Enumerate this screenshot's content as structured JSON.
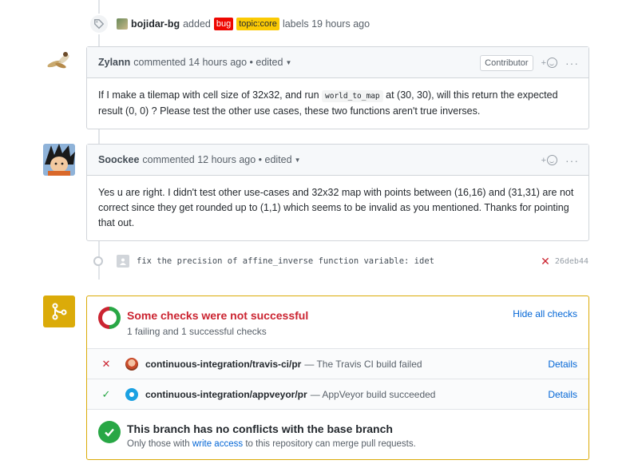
{
  "label_event": {
    "user": "bojidar-bg",
    "verb": "added",
    "labels": [
      "bug",
      "topic:core"
    ],
    "suffix": "labels 19 hours ago",
    "icon": "tag-icon"
  },
  "comments": [
    {
      "author": "Zylann",
      "meta": "commented 14 hours ago • edited",
      "role": "Contributor",
      "body_part1": "If I make a tilemap with cell size of 32x32, and run",
      "body_code": "world_to_map",
      "body_part2": "at (30, 30), will this return the expected result (0, 0) ? Please test the other use cases, these two functions aren't true inverses."
    },
    {
      "author": "Soockee",
      "meta": "commented 12 hours ago • edited",
      "body": "Yes u are right. I didn't test other use-cases and 32x32 map with points between (16,16) and (31,31) are not correct since they get rounded up to (1,1) which seems to be invalid as you mentioned. Thanks for pointing that out."
    }
  ],
  "commit": {
    "message": "fix the precision of affine_inverse function variable: idet",
    "status_icon": "x-icon",
    "sha": "26deb44"
  },
  "merge": {
    "checks_title": "Some checks were not successful",
    "checks_subtitle": "1 failing and 1 successful checks",
    "hide_label": "Hide all checks",
    "checks": [
      {
        "status": "fail",
        "name": "continuous-integration/travis-ci/pr",
        "description": "— The Travis CI build failed",
        "details": "Details"
      },
      {
        "status": "success",
        "name": "continuous-integration/appveyor/pr",
        "description": "— AppVeyor build succeeded",
        "details": "Details"
      }
    ],
    "conflict_title": "This branch has no conflicts with the base branch",
    "conflict_sub_prefix": "Only those with",
    "conflict_sub_link": "write access",
    "conflict_sub_suffix": "to this repository can merge pull requests."
  },
  "colors": {
    "fail": "#cb2431",
    "success": "#28a745",
    "warning": "#dbab09",
    "link": "#0366d6"
  }
}
